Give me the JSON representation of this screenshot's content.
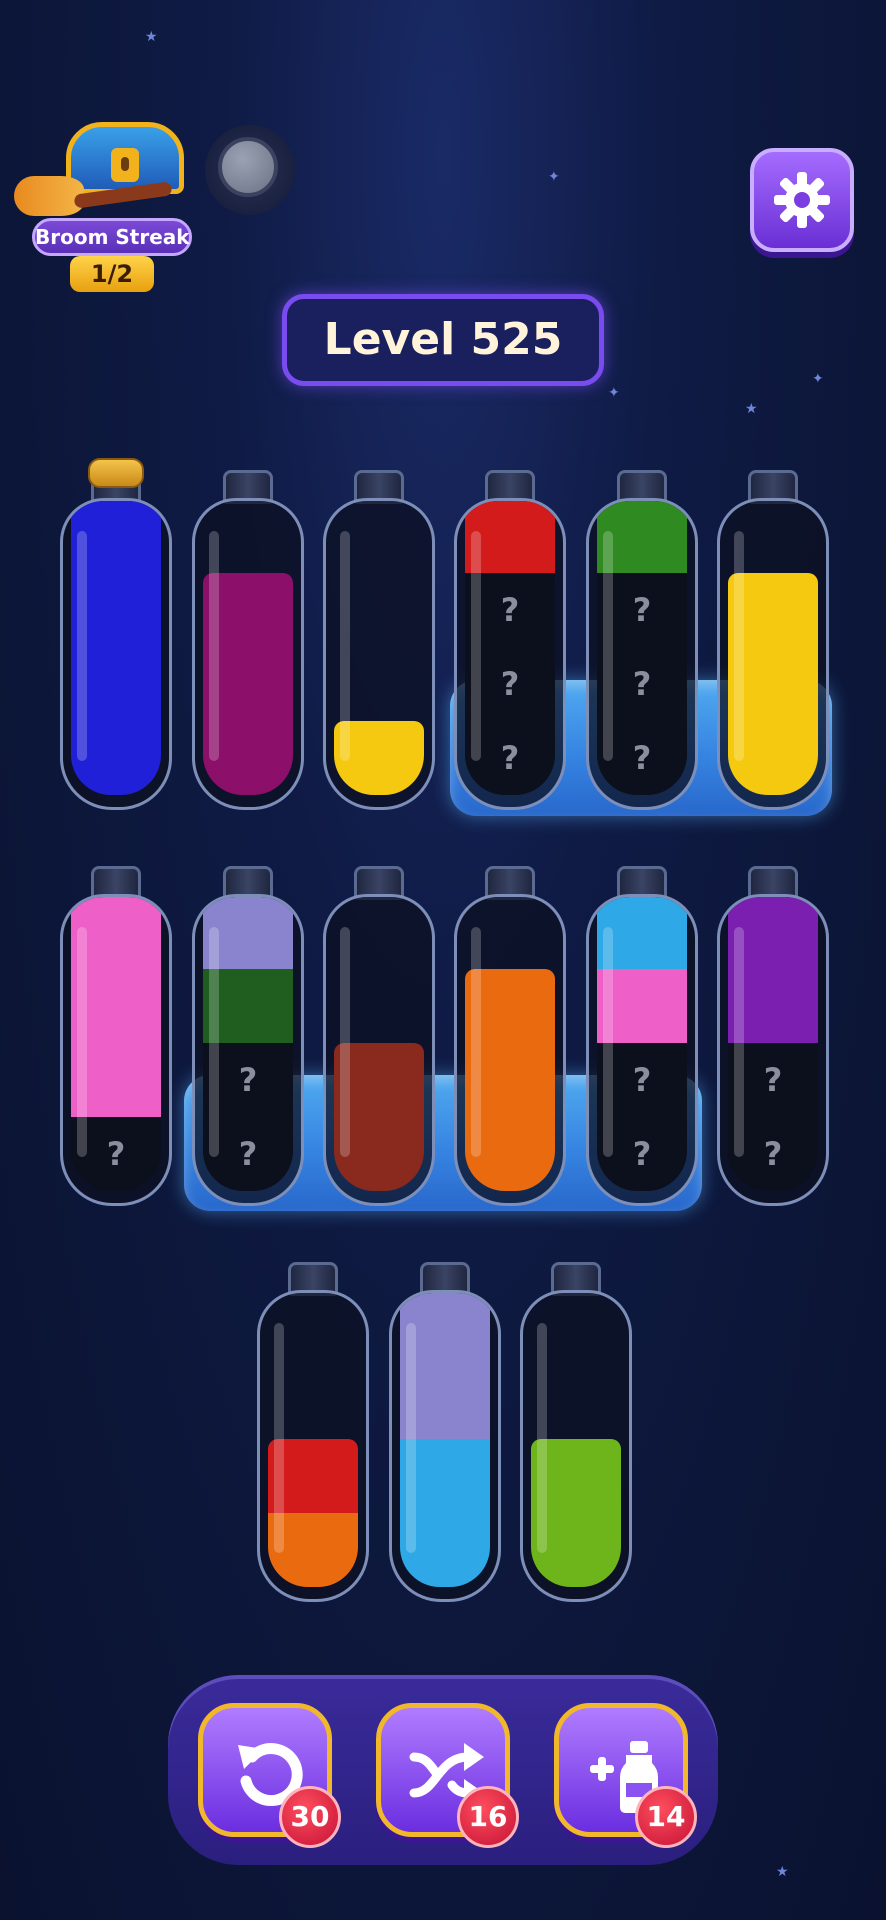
{
  "streak": {
    "label": "Broom Streak",
    "count": "1/2"
  },
  "level": {
    "title": "Level 525"
  },
  "bottles": [
    {
      "layers": [
        "blue",
        "blue",
        "blue",
        "blue"
      ],
      "corked": true,
      "frozen": false
    },
    {
      "layers": [
        "magenta",
        "magenta",
        "magenta"
      ],
      "corked": false,
      "frozen": false
    },
    {
      "layers": [
        "yellow"
      ],
      "corked": false,
      "frozen": false
    },
    {
      "layers": [
        "red",
        "mystery",
        "mystery",
        "mystery"
      ],
      "corked": false,
      "frozen": true
    },
    {
      "layers": [
        "green",
        "mystery",
        "mystery",
        "mystery"
      ],
      "corked": false,
      "frozen": true
    },
    {
      "layers": [
        "yellow",
        "yellow",
        "yellow"
      ],
      "corked": false,
      "frozen": true
    },
    {
      "layers": [
        "pink",
        "pink",
        "pink",
        "mystery"
      ],
      "corked": false,
      "frozen": false
    },
    {
      "layers": [
        "lavender",
        "darkgreen",
        "mystery",
        "mystery"
      ],
      "corked": false,
      "frozen": true
    },
    {
      "layers": [
        "brown",
        "brown"
      ],
      "corked": false,
      "frozen": true
    },
    {
      "layers": [
        "orange",
        "orange",
        "orange"
      ],
      "corked": false,
      "frozen": true
    },
    {
      "layers": [
        "skyblue",
        "pink",
        "mystery",
        "mystery"
      ],
      "corked": false,
      "frozen": true
    },
    {
      "layers": [
        "purple",
        "purple",
        "mystery",
        "mystery"
      ],
      "corked": false,
      "frozen": false
    },
    {
      "layers": [
        "red",
        "orange"
      ],
      "corked": false,
      "frozen": false
    },
    {
      "layers": [
        "lavender",
        "lavender",
        "skyblue",
        "skyblue"
      ],
      "corked": false,
      "frozen": false
    },
    {
      "layers": [
        "lime",
        "lime"
      ],
      "corked": false,
      "frozen": false
    }
  ],
  "colors": {
    "blue": "#2020d8",
    "magenta": "#8c0f6a",
    "yellow": "#f5c90f",
    "red": "#d41b1b",
    "green": "#2f8a22",
    "darkgreen": "#1f5e1f",
    "pink": "#ef5fc8",
    "lavender": "#8a84cf",
    "brown": "#8a2a1f",
    "orange": "#ea6a10",
    "skyblue": "#2ea8e6",
    "purple": "#7a1fb0",
    "lime": "#6db51a",
    "mystery": "#0c0f1c"
  },
  "mystery_mark": "?",
  "tools": [
    {
      "name": "undo",
      "icon": "undo-icon",
      "count": "30"
    },
    {
      "name": "shuffle",
      "icon": "shuffle-icon",
      "count": "16"
    },
    {
      "name": "add-bottle",
      "icon": "add-bottle-icon",
      "count": "14"
    }
  ]
}
